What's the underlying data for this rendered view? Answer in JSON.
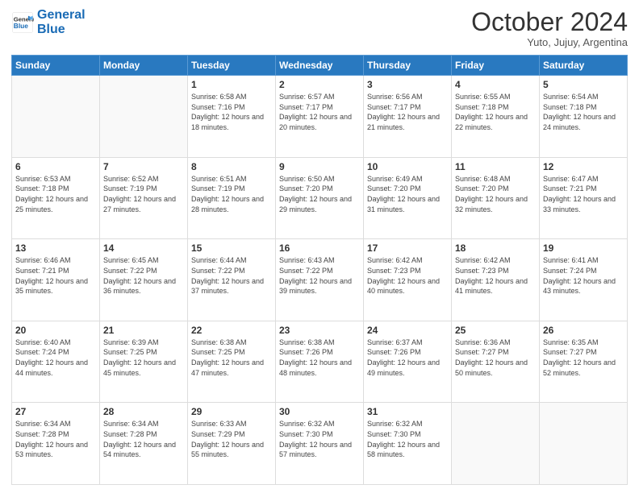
{
  "header": {
    "logo_line1": "General",
    "logo_line2": "Blue",
    "title": "October 2024",
    "subtitle": "Yuto, Jujuy, Argentina"
  },
  "days_of_week": [
    "Sunday",
    "Monday",
    "Tuesday",
    "Wednesday",
    "Thursday",
    "Friday",
    "Saturday"
  ],
  "weeks": [
    [
      {
        "day": "",
        "info": ""
      },
      {
        "day": "",
        "info": ""
      },
      {
        "day": "1",
        "info": "Sunrise: 6:58 AM\nSunset: 7:16 PM\nDaylight: 12 hours and 18 minutes."
      },
      {
        "day": "2",
        "info": "Sunrise: 6:57 AM\nSunset: 7:17 PM\nDaylight: 12 hours and 20 minutes."
      },
      {
        "day": "3",
        "info": "Sunrise: 6:56 AM\nSunset: 7:17 PM\nDaylight: 12 hours and 21 minutes."
      },
      {
        "day": "4",
        "info": "Sunrise: 6:55 AM\nSunset: 7:18 PM\nDaylight: 12 hours and 22 minutes."
      },
      {
        "day": "5",
        "info": "Sunrise: 6:54 AM\nSunset: 7:18 PM\nDaylight: 12 hours and 24 minutes."
      }
    ],
    [
      {
        "day": "6",
        "info": "Sunrise: 6:53 AM\nSunset: 7:18 PM\nDaylight: 12 hours and 25 minutes."
      },
      {
        "day": "7",
        "info": "Sunrise: 6:52 AM\nSunset: 7:19 PM\nDaylight: 12 hours and 27 minutes."
      },
      {
        "day": "8",
        "info": "Sunrise: 6:51 AM\nSunset: 7:19 PM\nDaylight: 12 hours and 28 minutes."
      },
      {
        "day": "9",
        "info": "Sunrise: 6:50 AM\nSunset: 7:20 PM\nDaylight: 12 hours and 29 minutes."
      },
      {
        "day": "10",
        "info": "Sunrise: 6:49 AM\nSunset: 7:20 PM\nDaylight: 12 hours and 31 minutes."
      },
      {
        "day": "11",
        "info": "Sunrise: 6:48 AM\nSunset: 7:20 PM\nDaylight: 12 hours and 32 minutes."
      },
      {
        "day": "12",
        "info": "Sunrise: 6:47 AM\nSunset: 7:21 PM\nDaylight: 12 hours and 33 minutes."
      }
    ],
    [
      {
        "day": "13",
        "info": "Sunrise: 6:46 AM\nSunset: 7:21 PM\nDaylight: 12 hours and 35 minutes."
      },
      {
        "day": "14",
        "info": "Sunrise: 6:45 AM\nSunset: 7:22 PM\nDaylight: 12 hours and 36 minutes."
      },
      {
        "day": "15",
        "info": "Sunrise: 6:44 AM\nSunset: 7:22 PM\nDaylight: 12 hours and 37 minutes."
      },
      {
        "day": "16",
        "info": "Sunrise: 6:43 AM\nSunset: 7:22 PM\nDaylight: 12 hours and 39 minutes."
      },
      {
        "day": "17",
        "info": "Sunrise: 6:42 AM\nSunset: 7:23 PM\nDaylight: 12 hours and 40 minutes."
      },
      {
        "day": "18",
        "info": "Sunrise: 6:42 AM\nSunset: 7:23 PM\nDaylight: 12 hours and 41 minutes."
      },
      {
        "day": "19",
        "info": "Sunrise: 6:41 AM\nSunset: 7:24 PM\nDaylight: 12 hours and 43 minutes."
      }
    ],
    [
      {
        "day": "20",
        "info": "Sunrise: 6:40 AM\nSunset: 7:24 PM\nDaylight: 12 hours and 44 minutes."
      },
      {
        "day": "21",
        "info": "Sunrise: 6:39 AM\nSunset: 7:25 PM\nDaylight: 12 hours and 45 minutes."
      },
      {
        "day": "22",
        "info": "Sunrise: 6:38 AM\nSunset: 7:25 PM\nDaylight: 12 hours and 47 minutes."
      },
      {
        "day": "23",
        "info": "Sunrise: 6:38 AM\nSunset: 7:26 PM\nDaylight: 12 hours and 48 minutes."
      },
      {
        "day": "24",
        "info": "Sunrise: 6:37 AM\nSunset: 7:26 PM\nDaylight: 12 hours and 49 minutes."
      },
      {
        "day": "25",
        "info": "Sunrise: 6:36 AM\nSunset: 7:27 PM\nDaylight: 12 hours and 50 minutes."
      },
      {
        "day": "26",
        "info": "Sunrise: 6:35 AM\nSunset: 7:27 PM\nDaylight: 12 hours and 52 minutes."
      }
    ],
    [
      {
        "day": "27",
        "info": "Sunrise: 6:34 AM\nSunset: 7:28 PM\nDaylight: 12 hours and 53 minutes."
      },
      {
        "day": "28",
        "info": "Sunrise: 6:34 AM\nSunset: 7:28 PM\nDaylight: 12 hours and 54 minutes."
      },
      {
        "day": "29",
        "info": "Sunrise: 6:33 AM\nSunset: 7:29 PM\nDaylight: 12 hours and 55 minutes."
      },
      {
        "day": "30",
        "info": "Sunrise: 6:32 AM\nSunset: 7:30 PM\nDaylight: 12 hours and 57 minutes."
      },
      {
        "day": "31",
        "info": "Sunrise: 6:32 AM\nSunset: 7:30 PM\nDaylight: 12 hours and 58 minutes."
      },
      {
        "day": "",
        "info": ""
      },
      {
        "day": "",
        "info": ""
      }
    ]
  ]
}
